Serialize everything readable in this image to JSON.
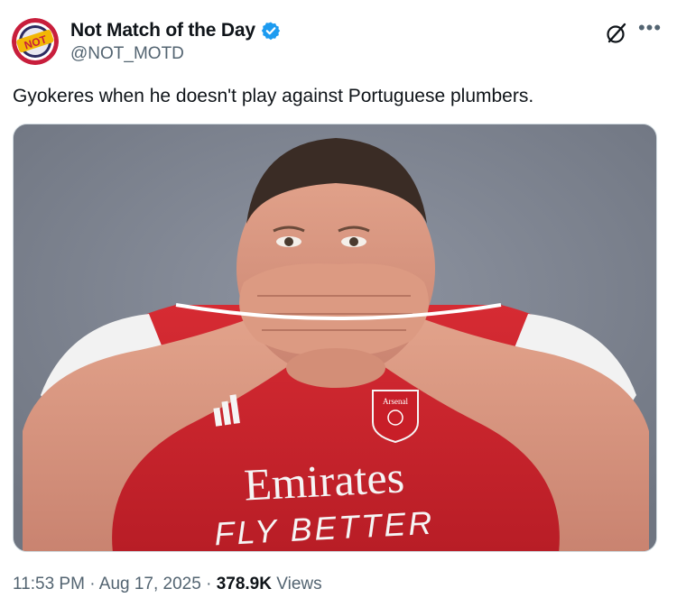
{
  "author": {
    "display_name": "Not Match of the Day",
    "handle": "@NOT_MOTD",
    "avatar_text": "NOT",
    "verified": true
  },
  "tweet": {
    "text": "Gyokeres when he doesn't play against Portuguese plumbers."
  },
  "media": {
    "shirt_sponsor": "Emirates",
    "shirt_slogan": "FLY BETTER",
    "club_crest": "Arsenal"
  },
  "footer": {
    "time": "11:53 PM",
    "separator": "·",
    "date": "Aug 17, 2025",
    "views_count": "378.9K",
    "views_label": "Views"
  },
  "icons": {
    "verified": "verified-badge-icon",
    "grok": "grok-icon",
    "more": "more-icon"
  },
  "colors": {
    "verified_blue": "#1d9bf0",
    "text_primary": "#0f1419",
    "text_secondary": "#536471",
    "shirt_red": "#d1262e",
    "background_grey": "#7d8390"
  }
}
